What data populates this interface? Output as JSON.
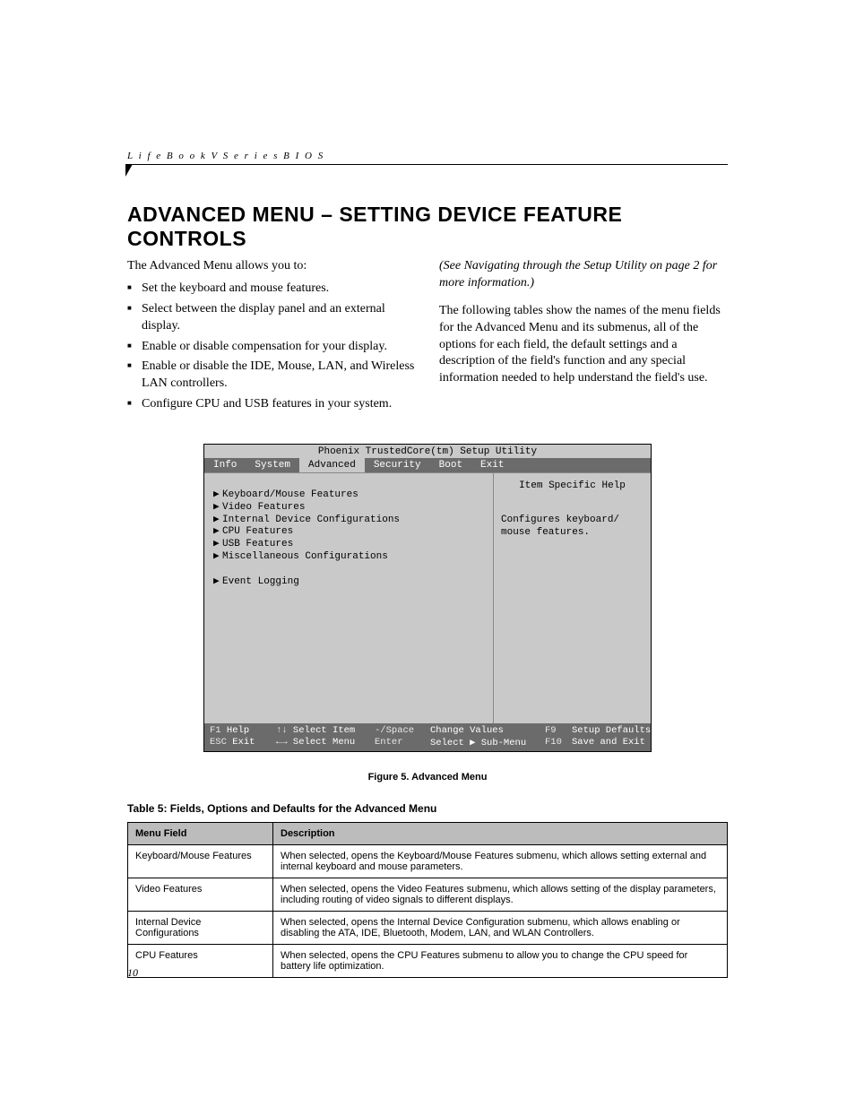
{
  "header": {
    "running": "L i f e B o o k   V   S e r i e s   B I O S"
  },
  "title": "ADVANCED MENU – SETTING DEVICE FEATURE CONTROLS",
  "left_col": {
    "intro": "The Advanced Menu allows you to:",
    "bullets": [
      "Set the keyboard and mouse features.",
      "Select between the display panel and an external display.",
      "Enable or disable compensation for your display.",
      "Enable or disable the IDE, Mouse, LAN, and Wireless LAN controllers.",
      "Configure CPU and USB features in your system."
    ]
  },
  "right_col": {
    "see": "(See Navigating through the Setup Utility on page 2 for more information.)",
    "para": "The following tables show the names of the menu fields for the Advanced Menu and its submenus, all of the options for each field, the default settings and a description of the field's function and any special information needed to help understand the field's use."
  },
  "bios": {
    "title": "Phoenix TrustedCore(tm) Setup Utility",
    "tabs": [
      "Info",
      "System",
      "Advanced",
      "Security",
      "Boot",
      "Exit"
    ],
    "active_tab": "Advanced",
    "menu": [
      "Keyboard/Mouse Features",
      "Video Features",
      "Internal Device Configurations",
      "CPU Features",
      "USB Features",
      "Miscellaneous Configurations"
    ],
    "menu_after_gap": [
      "Event Logging"
    ],
    "help_title": "Item Specific Help",
    "help_body": "Configures keyboard/ mouse features.",
    "footer": {
      "f1": "F1",
      "f1_label": "Help",
      "arrows_ud": "↑↓",
      "select_item": "Select Item",
      "minus_space": "-/Space",
      "change_values": "Change Values",
      "f9": "F9",
      "setup_defaults": "Setup Defaults",
      "esc": "ESC",
      "exit": "Exit",
      "arrows_lr": "←→",
      "select_menu": "Select Menu",
      "enter": "Enter",
      "select_submenu": "Select ▶ Sub-Menu",
      "f10": "F10",
      "save_exit": "Save and Exit"
    }
  },
  "figure_caption": "Figure 5.  Advanced Menu",
  "table_caption": "Table 5: Fields, Options and Defaults for the Advanced Menu",
  "table": {
    "headers": [
      "Menu Field",
      "Description"
    ],
    "rows": [
      {
        "field": "Keyboard/Mouse Features",
        "desc": "When selected, opens the Keyboard/Mouse Features submenu, which allows setting external and internal keyboard and mouse parameters."
      },
      {
        "field": "Video Features",
        "desc": "When selected, opens the Video Features submenu, which allows setting of the display parameters, including routing of video signals to different displays."
      },
      {
        "field": "Internal Device Configurations",
        "desc": "When selected, opens the Internal Device Configuration submenu, which allows enabling or disabling the ATA, IDE, Bluetooth, Modem, LAN, and WLAN Controllers."
      },
      {
        "field": "CPU Features",
        "desc": "When selected, opens the CPU Features submenu to allow you to change the CPU speed for battery life optimization."
      }
    ]
  },
  "page_number": "10"
}
